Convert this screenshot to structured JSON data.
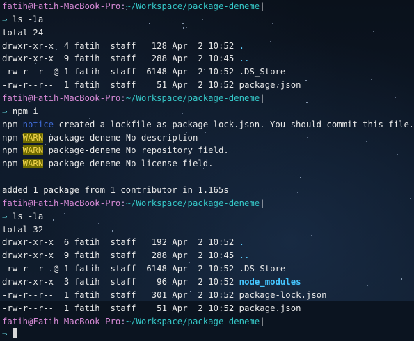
{
  "prompt": {
    "user": "fatih",
    "at": "@",
    "host": "Fatih-MacBook-Pro",
    "colon": ":",
    "path": "~/Workspace/package-deneme",
    "bar": "|",
    "arrow": "⇒"
  },
  "blocks": [
    {
      "command": "ls -la",
      "output": [
        {
          "type": "plain",
          "text": "total 24"
        },
        {
          "type": "ls",
          "perms": "drwxr-xr-x",
          "links": " 4",
          "owner": "fatih",
          "group": "staff",
          "size": " 128",
          "month": "Apr",
          "day": " 2",
          "time": "10:52",
          "name": ".",
          "kind": "dir"
        },
        {
          "type": "ls",
          "perms": "drwxr-xr-x",
          "links": " 9",
          "owner": "fatih",
          "group": "staff",
          "size": " 288",
          "month": "Apr",
          "day": " 2",
          "time": "10:45",
          "name": "..",
          "kind": "dir"
        },
        {
          "type": "ls",
          "perms": "-rw-r--r--@",
          "links": "1",
          "owner": "fatih",
          "group": "staff",
          "size": "6148",
          "month": "Apr",
          "day": " 2",
          "time": "10:52",
          "name": ".DS_Store",
          "kind": "file"
        },
        {
          "type": "ls",
          "perms": "-rw-r--r--",
          "links": " 1",
          "owner": "fatih",
          "group": "staff",
          "size": "  51",
          "month": "Apr",
          "day": " 2",
          "time": "10:52",
          "name": "package.json",
          "kind": "file"
        }
      ]
    },
    {
      "command": "npm i",
      "output": [
        {
          "type": "npm",
          "prefix": "npm",
          "level": "notice",
          "text": "created a lockfile as package-lock.json. You should commit this file."
        },
        {
          "type": "npm",
          "prefix": "npm",
          "level": "WARN",
          "text": "package-deneme No description"
        },
        {
          "type": "npm",
          "prefix": "npm",
          "level": "WARN",
          "text": "package-deneme No repository field."
        },
        {
          "type": "npm",
          "prefix": "npm",
          "level": "WARN",
          "text": "package-deneme No license field."
        },
        {
          "type": "plain",
          "text": ""
        },
        {
          "type": "plain",
          "text": "added 1 package from 1 contributor in 1.165s"
        }
      ]
    },
    {
      "command": "ls -la",
      "output": [
        {
          "type": "plain",
          "text": "total 32"
        },
        {
          "type": "ls",
          "perms": "drwxr-xr-x",
          "links": " 6",
          "owner": "fatih",
          "group": "staff",
          "size": " 192",
          "month": "Apr",
          "day": " 2",
          "time": "10:52",
          "name": ".",
          "kind": "dir"
        },
        {
          "type": "ls",
          "perms": "drwxr-xr-x",
          "links": " 9",
          "owner": "fatih",
          "group": "staff",
          "size": " 288",
          "month": "Apr",
          "day": " 2",
          "time": "10:45",
          "name": "..",
          "kind": "dir"
        },
        {
          "type": "ls",
          "perms": "-rw-r--r--@",
          "links": "1",
          "owner": "fatih",
          "group": "staff",
          "size": "6148",
          "month": "Apr",
          "day": " 2",
          "time": "10:52",
          "name": ".DS_Store",
          "kind": "file"
        },
        {
          "type": "ls",
          "perms": "drwxr-xr-x",
          "links": " 3",
          "owner": "fatih",
          "group": "staff",
          "size": "  96",
          "month": "Apr",
          "day": " 2",
          "time": "10:52",
          "name": "node_modules",
          "kind": "dirbold"
        },
        {
          "type": "ls",
          "perms": "-rw-r--r--",
          "links": " 1",
          "owner": "fatih",
          "group": "staff",
          "size": " 301",
          "month": "Apr",
          "day": " 2",
          "time": "10:52",
          "name": "package-lock.json",
          "kind": "file"
        },
        {
          "type": "ls",
          "perms": "-rw-r--r--",
          "links": " 1",
          "owner": "fatih",
          "group": "staff",
          "size": "  51",
          "month": "Apr",
          "day": " 2",
          "time": "10:52",
          "name": "package.json",
          "kind": "file"
        }
      ]
    },
    {
      "command": "",
      "output": []
    }
  ],
  "colors": {
    "user": "#d78ad6",
    "path": "#35c7c7",
    "dir": "#5cd0ff",
    "notice": "#3f6bd6",
    "warn_bg": "#6f6b00",
    "warn_fg": "#f1d44b"
  }
}
